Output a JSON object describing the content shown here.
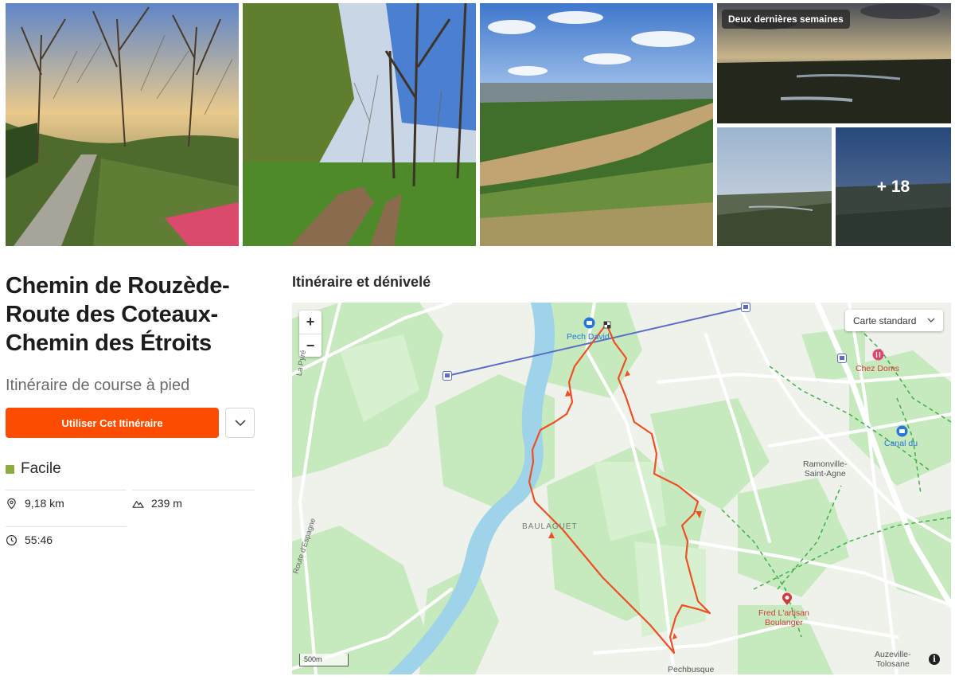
{
  "gallery": {
    "badge": "Deux dernières semaines",
    "more_count": "+ 18"
  },
  "route": {
    "title": "Chemin de Rouzède-Route des Coteaux-Chemin des Étroits",
    "subtitle": "Itinéraire de course à pied",
    "use_button": "Utiliser Cet Itinéraire",
    "difficulty": "Facile",
    "difficulty_color": "#8bad3f",
    "accent_color": "#fc4c02",
    "stats": {
      "distance": "9,18 km",
      "elevation": "239 m",
      "time": "55:46"
    }
  },
  "map": {
    "heading": "Itinéraire et dénivelé",
    "style_select": "Carte standard",
    "zoom_in": "+",
    "zoom_out": "−",
    "scale": "500m",
    "info": "i",
    "route_color": "#f04e23",
    "labels": {
      "pech_david": "Pech David",
      "chez_doms": "Chez Doms",
      "canal_du": "Canal du",
      "ramonville": "Ramonville-\nSaint-Agne",
      "baulaguet": "BAULAGUET",
      "fred": "Fred L'artisan\nBoulanger",
      "pechbusque": "Pechbusque",
      "auzeville": "Auzeville-\nTolosane",
      "route_espagne": "Route d'Espagne",
      "la_pyrenee": "La Pyré"
    }
  }
}
